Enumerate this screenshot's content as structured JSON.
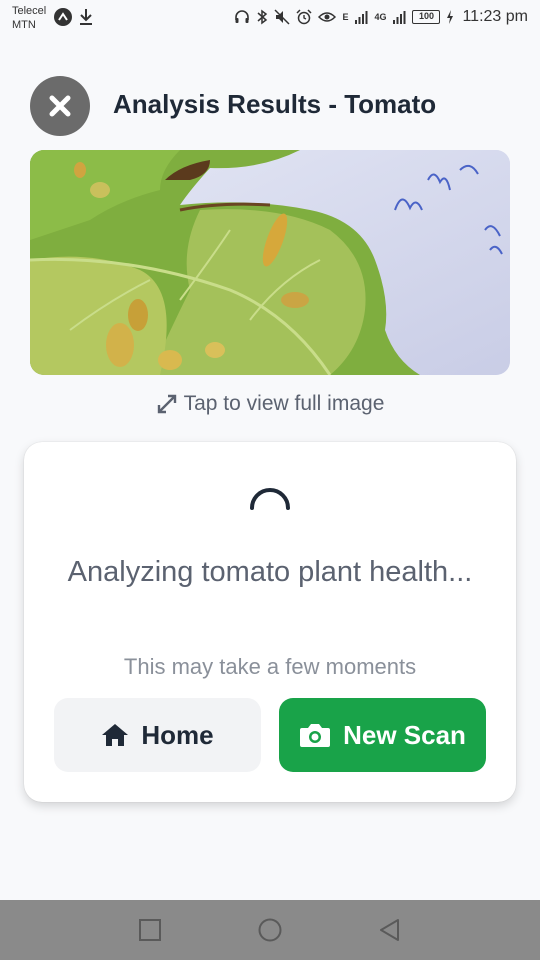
{
  "status_bar": {
    "carrier_line1": "Telecel",
    "carrier_line2": "MTN",
    "time": "11:23 pm",
    "battery": "100",
    "network_label": "4G",
    "signal_label": "E"
  },
  "header": {
    "title": "Analysis Results - Tomato",
    "close_icon": "close-icon"
  },
  "image": {
    "hint": "Tap to view full image",
    "hint_icon": "expand-icon"
  },
  "analysis": {
    "status": "Analyzing tomato plant health...",
    "subtext": "This may take a few moments",
    "buttons": {
      "home_label": "Home",
      "home_icon": "home-icon",
      "scan_label": "New Scan",
      "scan_icon": "camera-icon"
    }
  },
  "colors": {
    "primary_green": "#19a349",
    "close_button": "#6b6b6b",
    "nav_bar": "#8a8a8a"
  }
}
